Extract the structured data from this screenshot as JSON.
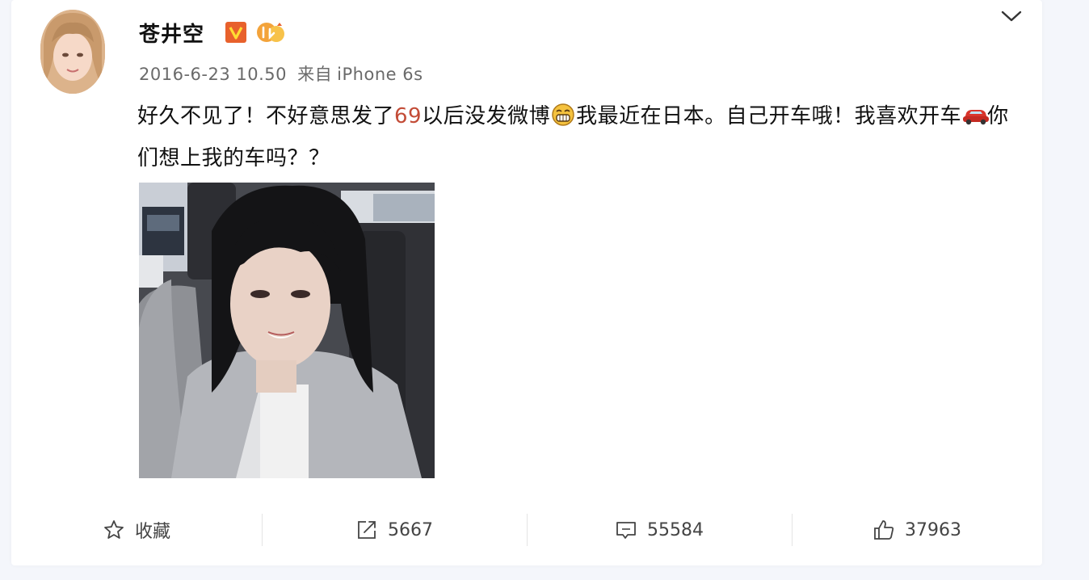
{
  "post": {
    "username": "苍井空",
    "meta": {
      "timestamp": "2016-6-23 10.50",
      "source_prefix": "来自",
      "source_device": "iPhone 6s"
    },
    "text": {
      "part1": "好久不见了！不好意思发了",
      "num": "69",
      "part2": "以后没发微博",
      "part3": "我最近在日本。自己开车哦！我喜欢开车",
      "part4": "你们想上我的车吗？？"
    },
    "icons": {
      "verified": "verified-v-icon",
      "vip": "vip-level-icon",
      "menu": "chevron-down-icon",
      "emoji1": "grin-emoji",
      "emoji2": "car-emoji"
    }
  },
  "actions": {
    "favorite_label": "收藏",
    "repost_count": "5667",
    "comment_count": "55584",
    "like_count": "37963"
  },
  "colors": {
    "background": "#f4f6fb",
    "card": "#ffffff",
    "accent_number": "#c34c37",
    "verified_badge": "#e8612c",
    "vip_badge": "#f3a33a",
    "meta_text": "#6a6a6a"
  }
}
